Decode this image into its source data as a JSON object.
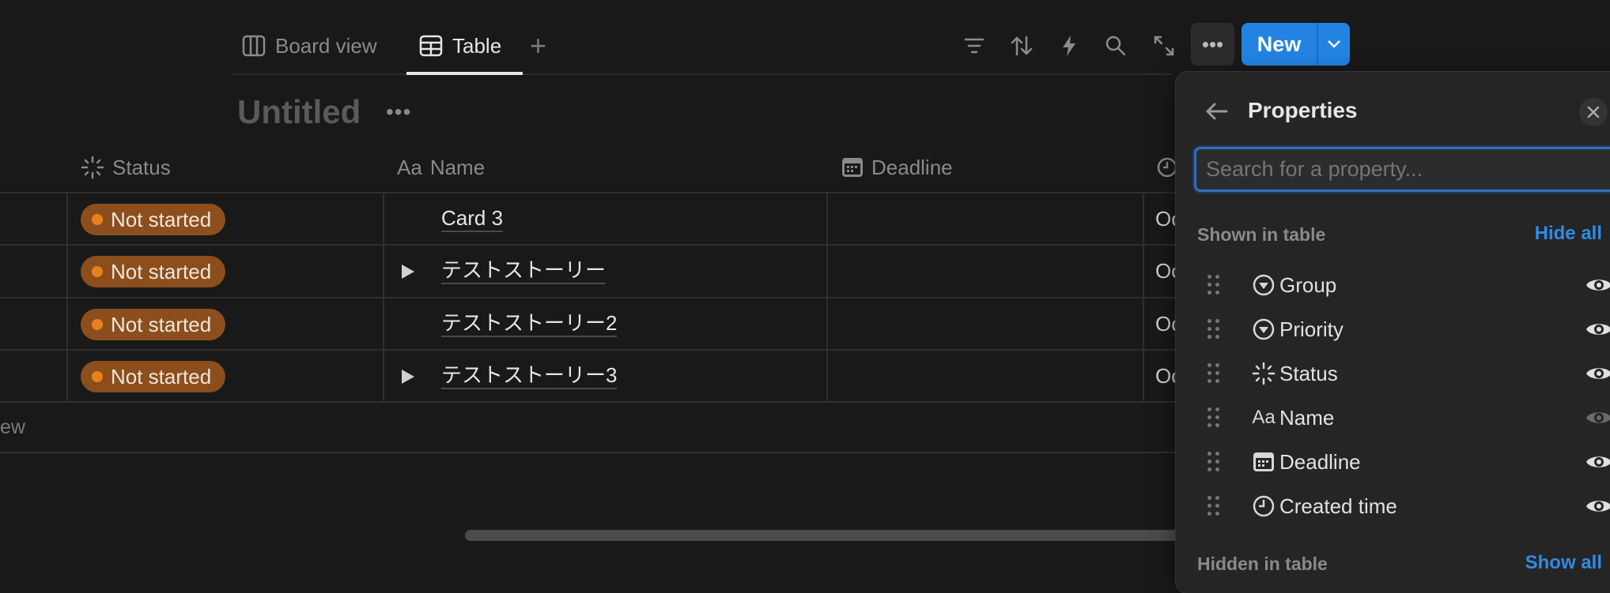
{
  "tabs": [
    {
      "label": "Board view",
      "icon": "board-icon"
    },
    {
      "label": "Table",
      "icon": "table-icon",
      "active": true
    }
  ],
  "add_view": "+",
  "toolbar": {
    "icons": [
      "filter-icon",
      "sort-icon",
      "automation-bolt-icon",
      "search-icon",
      "expand-icon"
    ],
    "more": "•••",
    "new_label": "New",
    "new_dropdown": "chevron-down-icon"
  },
  "database": {
    "title": "Untitled",
    "more": "•••"
  },
  "table": {
    "columns": [
      {
        "label": "Status",
        "icon": "status-icon"
      },
      {
        "label": "Name",
        "icon": "Aa"
      },
      {
        "label": "Deadline",
        "icon": "calendar-icon"
      },
      {
        "label": "",
        "icon": "clock-icon"
      }
    ],
    "rows": [
      {
        "status": "Not started",
        "name": "Card 3",
        "expandable": false,
        "created": "Oc"
      },
      {
        "status": "Not started",
        "name": "テストストーリー",
        "expandable": true,
        "created": "Oc"
      },
      {
        "status": "Not started",
        "name": "テストストーリー2",
        "expandable": false,
        "created": "Oc"
      },
      {
        "status": "Not started",
        "name": "テストストーリー3",
        "expandable": true,
        "created": "Oc"
      }
    ],
    "new_row": "ew"
  },
  "properties_panel": {
    "title": "Properties",
    "search_placeholder": "Search for a property...",
    "shown_label": "Shown in table",
    "hide_all": "Hide all",
    "hidden_label": "Hidden in table",
    "show_all": "Show all",
    "items": [
      {
        "label": "Group",
        "icon": "select-icon",
        "visible": true
      },
      {
        "label": "Priority",
        "icon": "select-icon",
        "visible": true
      },
      {
        "label": "Status",
        "icon": "status-icon",
        "visible": true
      },
      {
        "label": "Name",
        "icon": "Aa",
        "visible": true,
        "locked": true
      },
      {
        "label": "Deadline",
        "icon": "calendar-icon",
        "visible": true
      },
      {
        "label": "Created time",
        "icon": "clock-icon",
        "visible": true
      }
    ]
  },
  "colors": {
    "background": "#191919",
    "panel": "#252525",
    "accent": "#2383e2",
    "status_pill": "#8b4e1c",
    "status_dot": "#e8811c"
  }
}
